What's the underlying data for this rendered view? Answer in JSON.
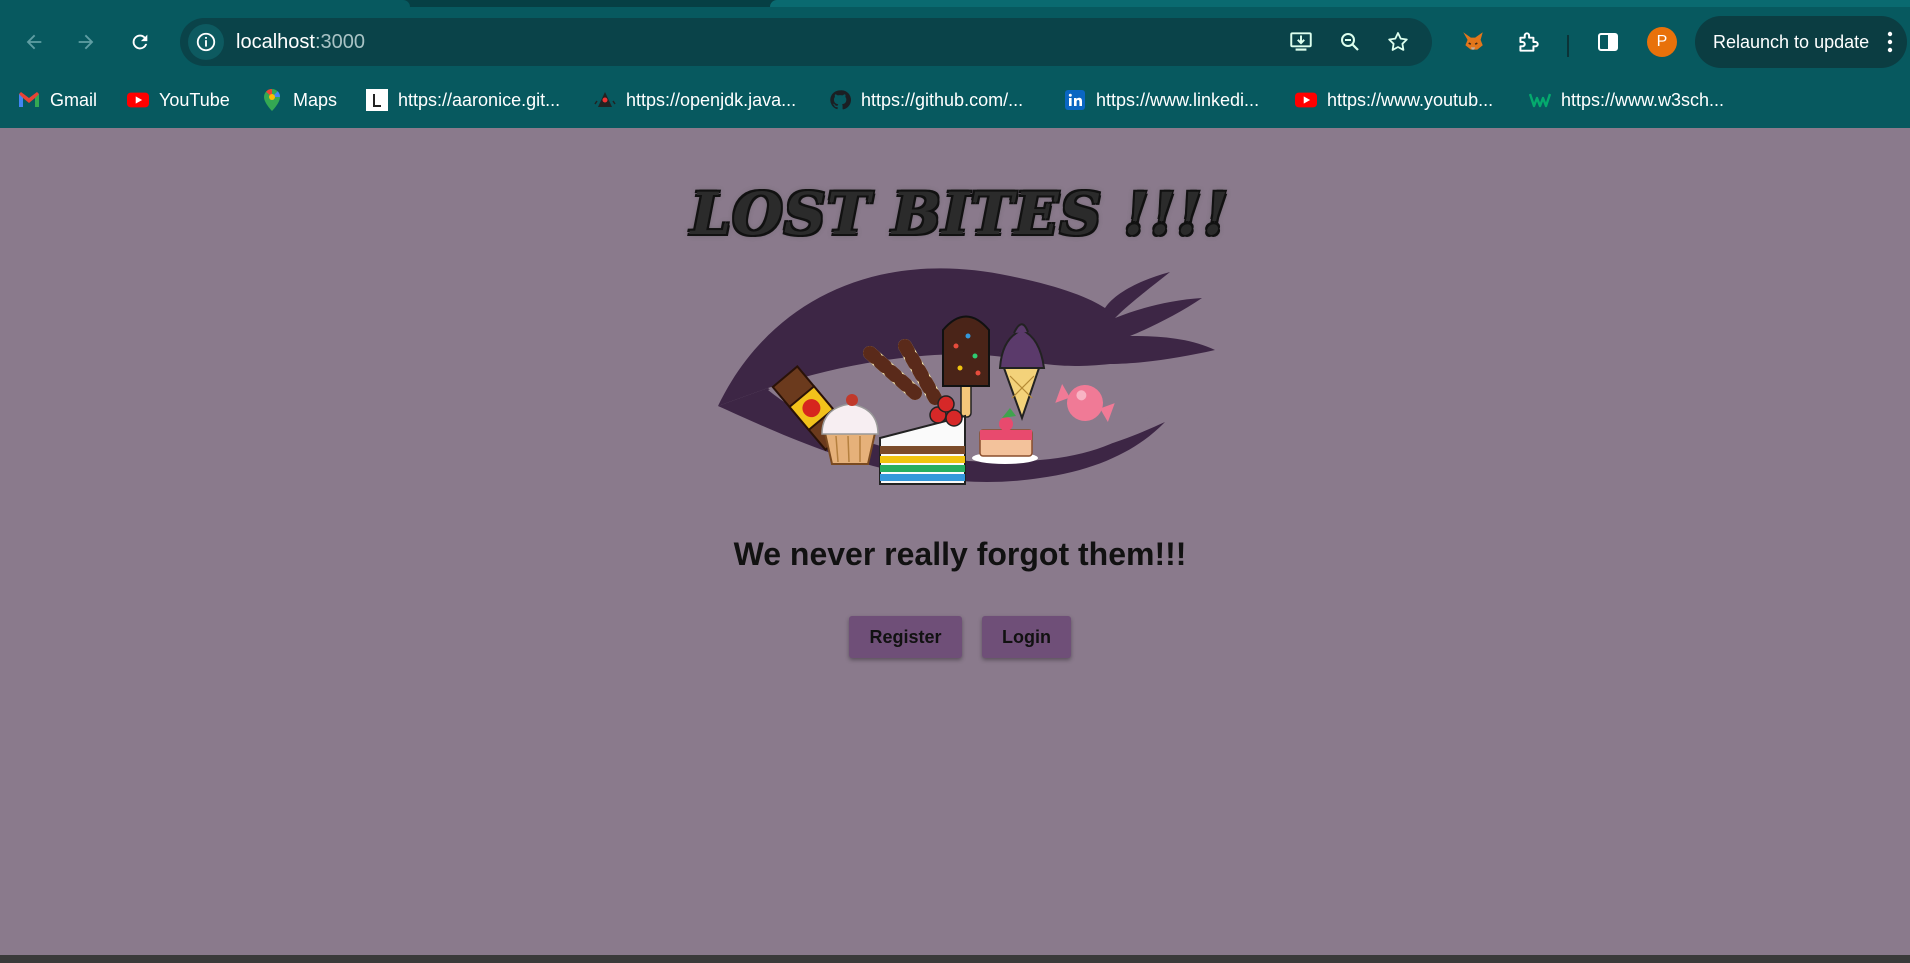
{
  "browser": {
    "url_host": "localhost",
    "url_port": ":3000",
    "profile_initial": "P",
    "relaunch_label": "Relaunch to update"
  },
  "bookmarks": [
    {
      "label": "Gmail",
      "icon": "gmail-icon"
    },
    {
      "label": "YouTube",
      "icon": "youtube-icon"
    },
    {
      "label": "Maps",
      "icon": "maps-icon"
    },
    {
      "label": "https://aaronice.git...",
      "icon": "letter-l-icon"
    },
    {
      "label": "https://openjdk.java...",
      "icon": "openjdk-duke-icon"
    },
    {
      "label": "https://github.com/...",
      "icon": "github-icon"
    },
    {
      "label": "https://www.linkedi...",
      "icon": "linkedin-icon"
    },
    {
      "label": "https://www.youtub...",
      "icon": "youtube-icon"
    },
    {
      "label": "https://www.w3sch...",
      "icon": "w3schools-icon"
    }
  ],
  "page": {
    "logo_text": "LOST BITES !!!!",
    "tagline": "We never really forgot them!!!",
    "register_label": "Register",
    "login_label": "Login"
  },
  "colors": {
    "chrome": "#07595f",
    "page_background": "#8a7a8c",
    "button": "#6f4f78",
    "eye_outline": "#3d2645"
  }
}
